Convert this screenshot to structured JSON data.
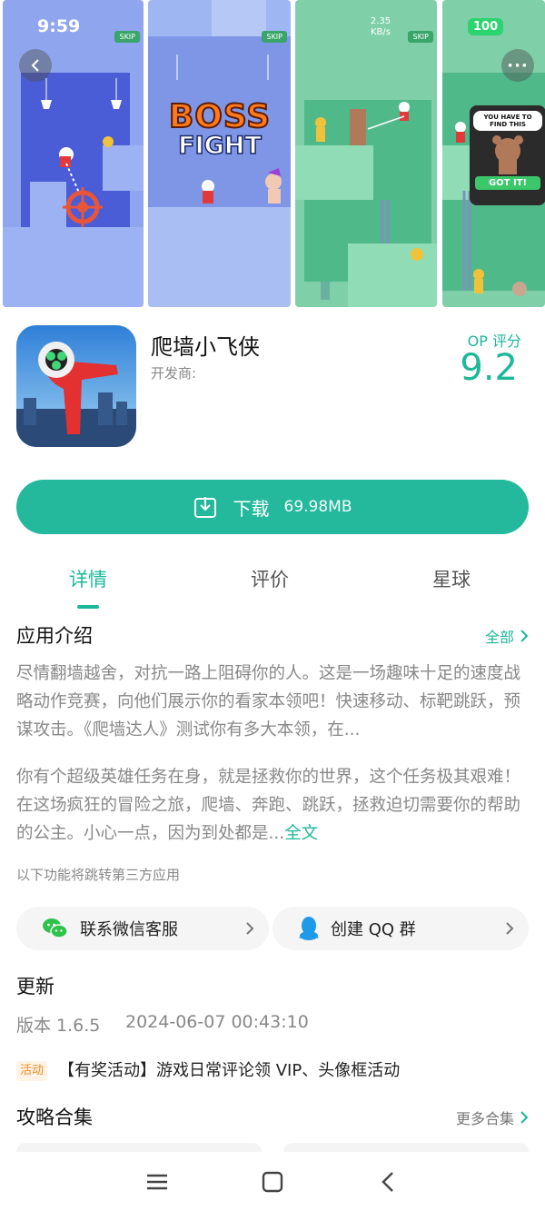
{
  "status_bar": {
    "time": "9:59",
    "speed": "2.35 KB/s",
    "battery": "100"
  },
  "screenshots": {
    "skip_label": "SKIP",
    "boss_text_1": "BOSS",
    "boss_text_2": "FIGHT",
    "bubble_text": "YOU HAVE TO FIND THIS",
    "got_it_label": "GOT IT!"
  },
  "app": {
    "name": "爬墙小飞侠",
    "developer_label": "开发商:",
    "score_label": "OP 评分",
    "score": "9.2"
  },
  "download": {
    "label": "下载",
    "size": "69.98MB"
  },
  "tabs": [
    {
      "label": "详情",
      "active": true
    },
    {
      "label": "评价",
      "active": false
    },
    {
      "label": "星球",
      "active": false
    }
  ],
  "intro": {
    "title": "应用介绍",
    "more": "全部",
    "paragraph1": "尽情翻墙越舍，对抗一路上阻碍你的人。这是一场趣味十足的速度战略动作竞赛，向他们展示你的看家本领吧！快速移动、标靶跳跃，预谋攻击。《爬墙达人》测试你有多大本领，在...",
    "paragraph2": "你有个超级英雄任务在身，就是拯救你的世界，这个任务极其艰难！在这场疯狂的冒险之旅，爬墙、奔跑、跳跃，拯救迫切需要你的帮助的公主。小心一点，因为到处都是...",
    "full_text_link": "全文",
    "third_party_note": "以下功能将跳转第三方应用"
  },
  "contacts": [
    {
      "label": "联系微信客服",
      "icon": "wechat-icon"
    },
    {
      "label": "创建 QQ 群",
      "icon": "qq-icon"
    }
  ],
  "update": {
    "title": "更新",
    "version": "版本 1.6.5",
    "date": "2024-06-07 00:43:10"
  },
  "activity": {
    "badge": "活动",
    "text": "【有奖活动】游戏日常评论领 VIP、头像框活动"
  },
  "guides": {
    "title": "攻略合集",
    "more": "更多合集"
  },
  "colors": {
    "accent": "#24b89c",
    "accent_text": "#1db79a"
  }
}
